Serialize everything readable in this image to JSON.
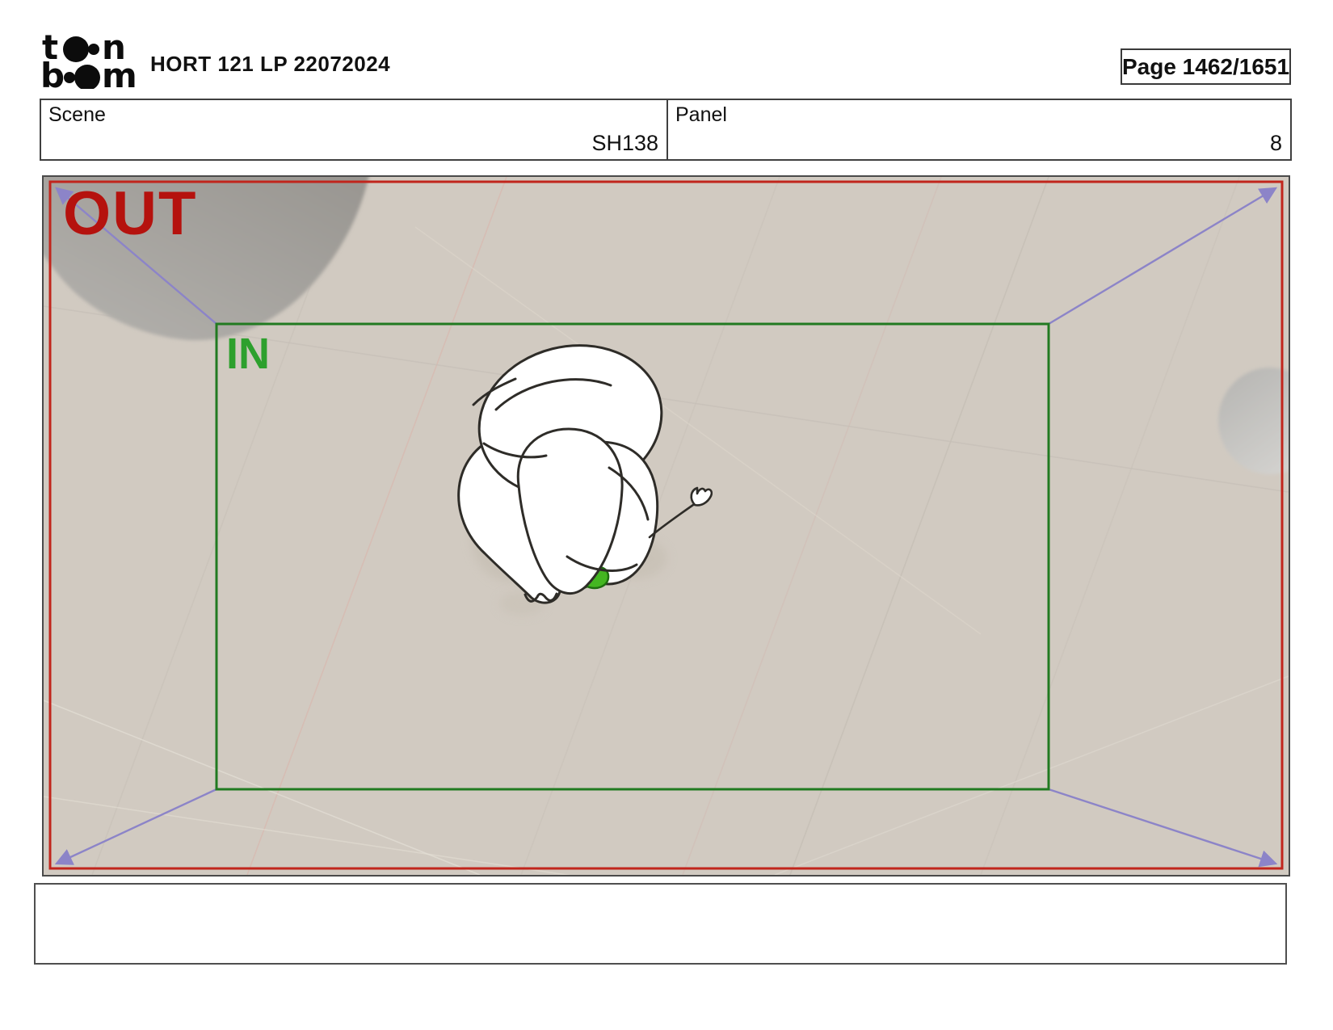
{
  "header": {
    "logo": {
      "t1": "t",
      "t2": "n",
      "t3": "b",
      "t4": "m"
    },
    "title": "HORT 121 LP 22072024",
    "page_label": "Page 1462/1651"
  },
  "info_row": {
    "scene_label": "Scene",
    "scene_value": "SH138",
    "panel_label": "Panel",
    "panel_value": "8"
  },
  "panel": {
    "out_label": "OUT",
    "in_label": "IN",
    "colors": {
      "floor": "#d1cac1",
      "out_frame": "#c1251c",
      "out_text": "#b5120e",
      "in_frame": "#217a21",
      "in_text": "#2da02d",
      "camera_arrow": "#8c84c8"
    }
  },
  "caption": {
    "text": ""
  }
}
